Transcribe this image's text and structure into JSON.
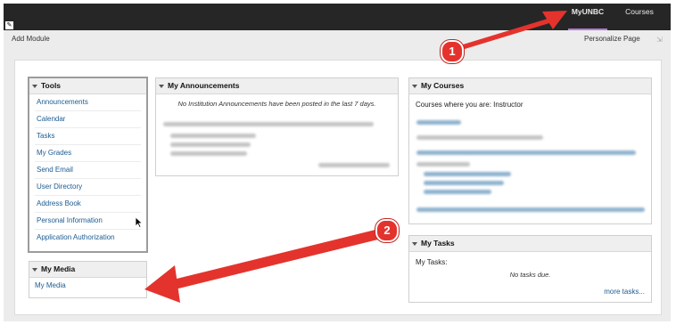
{
  "topbar": {
    "tabs": [
      {
        "label": "MyUNBC",
        "active": true
      },
      {
        "label": "Courses",
        "active": false
      }
    ],
    "active_underline_color": "#b07ad6"
  },
  "toolbar": {
    "add_module_label": "Add Module",
    "personalize_label": "Personalize Page"
  },
  "tools": {
    "title": "Tools",
    "items": [
      "Announcements",
      "Calendar",
      "Tasks",
      "My Grades",
      "Send Email",
      "User Directory",
      "Address Book",
      "Personal Information",
      "Application Authorization"
    ]
  },
  "media": {
    "title": "My Media",
    "link": "My Media"
  },
  "announcements": {
    "title": "My Announcements",
    "note": "No Institution Announcements have been posted in the last 7 days."
  },
  "courses": {
    "title": "My Courses",
    "lead": "Courses where you are: Instructor"
  },
  "tasks": {
    "title": "My Tasks",
    "label": "My Tasks:",
    "empty": "No tasks due.",
    "more": "more tasks..."
  },
  "callouts": [
    {
      "number": "1",
      "color": "#e4332d"
    },
    {
      "number": "2",
      "color": "#e4332d"
    }
  ],
  "colors": {
    "link": "#1c5c91",
    "topbar_bg": "#262626",
    "arrow": "#e4332d"
  }
}
